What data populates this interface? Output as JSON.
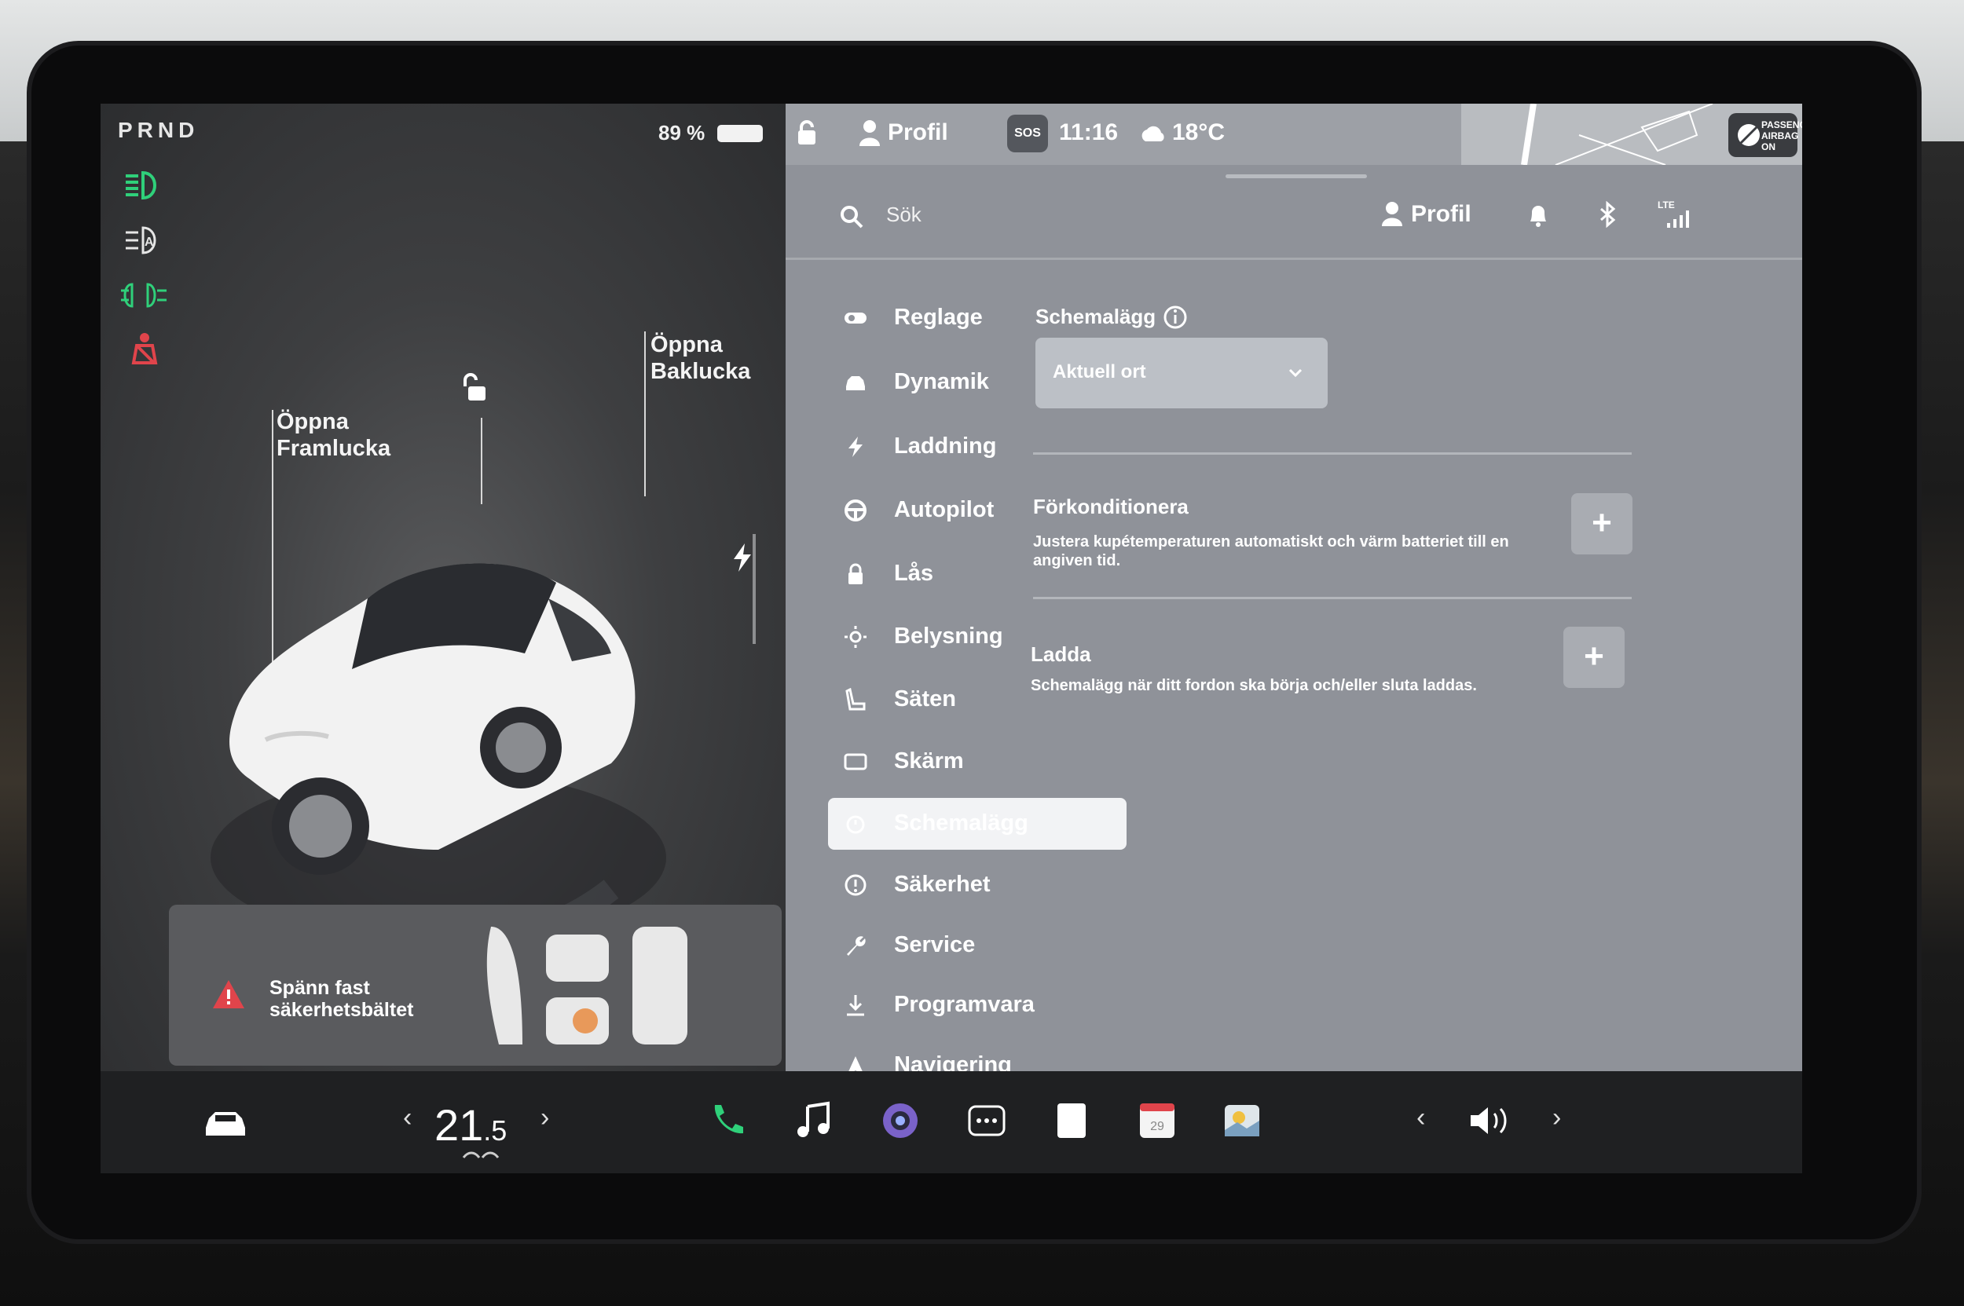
{
  "left_panel": {
    "gear": "PRND",
    "battery": "89 %",
    "callout_front": "Öppna\nFramlucka",
    "callout_rear": "Öppna\nBaklucka",
    "alert": "Spänn fast\nsäkerhetsbältet"
  },
  "topbar": {
    "profile": "Profil",
    "sos": "SOS",
    "time": "11:16",
    "weather": "18°C",
    "airbag": "PASSENGER\nAIRBAG ON"
  },
  "search": {
    "placeholder": "Sök",
    "profile": "Profil",
    "signal": "LTE"
  },
  "menu": {
    "items": [
      {
        "label": "Reglage",
        "icon": "toggle-icon"
      },
      {
        "label": "Dynamik",
        "icon": "car-icon"
      },
      {
        "label": "Laddning",
        "icon": "lightning-icon"
      },
      {
        "label": "Autopilot",
        "icon": "steering-wheel-icon"
      },
      {
        "label": "Lås",
        "icon": "lock-icon"
      },
      {
        "label": "Belysning",
        "icon": "sun-icon"
      },
      {
        "label": "Säten",
        "icon": "seat-icon"
      },
      {
        "label": "Skärm",
        "icon": "display-icon"
      },
      {
        "label": "Schemalägg",
        "icon": "alarm-icon",
        "active": true
      },
      {
        "label": "Säkerhet",
        "icon": "info-icon"
      },
      {
        "label": "Service",
        "icon": "wrench-icon"
      },
      {
        "label": "Programvara",
        "icon": "download-icon"
      },
      {
        "label": "Navigering",
        "icon": "navigation-icon"
      }
    ]
  },
  "schedule": {
    "title": "Schemalägg",
    "location": "Aktuell ort",
    "precondition_title": "Förkonditionera",
    "precondition_desc": "Justera kupétemperaturen automatiskt och värm batteriet till en angiven tid.",
    "charge_title": "Ladda",
    "charge_desc": "Schemalägg när ditt fordon ska börja och/eller sluta laddas.",
    "add": "+"
  },
  "bottom": {
    "temp_main": "21",
    "temp_dec": ".5",
    "calendar_day": "29",
    "left": "‹",
    "right": "›"
  },
  "colors": {
    "accent_green": "#2fd07a",
    "warning_red": "#e0444b"
  }
}
